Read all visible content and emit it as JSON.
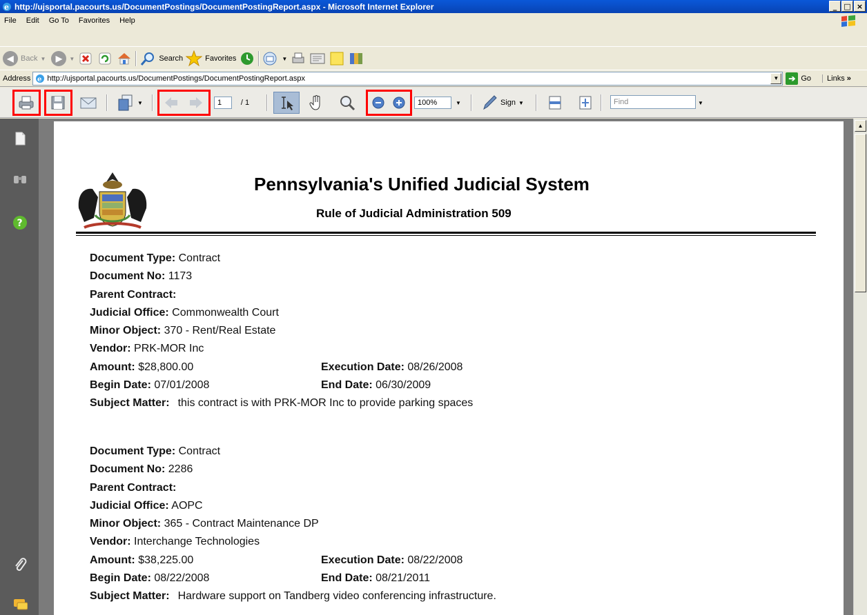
{
  "window": {
    "title": "http://ujsportal.pacourts.us/DocumentPostings/DocumentPostingReport.aspx - Microsoft Internet Explorer",
    "controls": [
      "_",
      "□",
      "×"
    ]
  },
  "menu": [
    "File",
    "Edit",
    "Go To",
    "Favorites",
    "Help"
  ],
  "std_toolbar": {
    "back": "Back",
    "search": "Search",
    "favorites": "Favorites"
  },
  "address": {
    "label": "Address",
    "url": "http://ujsportal.pacourts.us/DocumentPostings/DocumentPostingReport.aspx",
    "go": "Go",
    "links": "Links"
  },
  "reader_toolbar": {
    "page_current": "1",
    "page_total": "/ 1",
    "zoom": "100%",
    "sign": "Sign",
    "find_placeholder": "Find"
  },
  "document": {
    "title": "Pennsylvania's Unified Judicial System",
    "subtitle": "Rule of Judicial Administration 509",
    "labels": {
      "type": "Document Type:",
      "no": "Document No:",
      "parent": "Parent Contract:",
      "office": "Judicial Office:",
      "minor": "Minor Object:",
      "vendor": "Vendor:",
      "amount": "Amount:",
      "exec": "Execution Date:",
      "begin": "Begin Date:",
      "end": "End Date:",
      "subject": "Subject Matter:"
    },
    "records": [
      {
        "type": "Contract",
        "no": "1173",
        "parent": "",
        "office": "Commonwealth Court",
        "minor": "370 - Rent/Real Estate",
        "vendor": "PRK-MOR Inc",
        "amount": "$28,800.00",
        "exec": "08/26/2008",
        "begin": "07/01/2008",
        "end": "06/30/2009",
        "subject": "this contract is with PRK-MOR Inc to provide parking spaces"
      },
      {
        "type": "Contract",
        "no": "2286",
        "parent": "",
        "office": "AOPC",
        "minor": "365 - Contract Maintenance DP",
        "vendor": "Interchange Technologies",
        "amount": "$38,225.00",
        "exec": "08/22/2008",
        "begin": "08/22/2008",
        "end": "08/21/2011",
        "subject": "Hardware support on Tandberg video conferencing infrastructure."
      }
    ]
  },
  "colors": {
    "titlebar": "#0a58d8",
    "highlight_box": "#ff0000",
    "nav_panel": "#5b5b5b",
    "doc_bg": "#7b7b7b"
  },
  "icons": [
    "ie-icon",
    "windows-logo-icon",
    "back-icon",
    "forward-icon",
    "stop-icon",
    "refresh-icon",
    "home-icon",
    "search-icon",
    "favorites-star-icon",
    "history-icon",
    "mail-icon",
    "print-icon",
    "edit-icon",
    "notes-icon",
    "research-icon",
    "save-icon",
    "email-icon",
    "previous-page-icon",
    "next-page-icon",
    "select-text-icon",
    "hand-tool-icon",
    "zoom-tool-icon",
    "zoom-out-icon",
    "zoom-in-icon",
    "sign-pen-icon",
    "fit-width-icon",
    "fit-page-icon",
    "pages-icon",
    "binoculars-icon",
    "help-icon",
    "attachment-icon",
    "comments-icon"
  ]
}
